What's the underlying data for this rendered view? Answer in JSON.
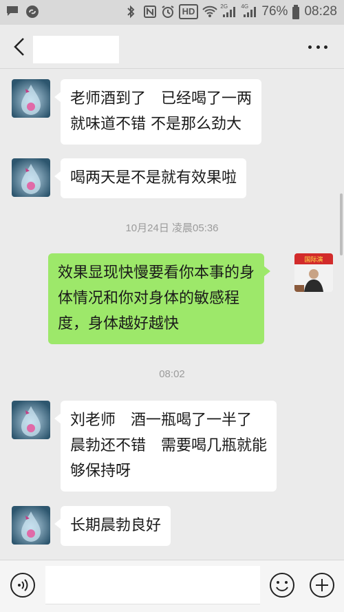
{
  "status_bar": {
    "battery_percent": "76%",
    "time": "08:28",
    "hd_label": "HD",
    "net_2g": "2G",
    "net_4g": "4G"
  },
  "header": {
    "title": ""
  },
  "messages": [
    {
      "direction": "in",
      "lines": [
        "老师酒到了　已经喝了一两",
        "就味道不错  不是那么劲大"
      ]
    },
    {
      "direction": "in",
      "lines": [
        "喝两天是不是就有效果啦"
      ]
    },
    {
      "timestamp": "10月24日 凌晨05:36"
    },
    {
      "direction": "out",
      "lines": [
        "效果显现快慢要看你本事的身",
        "体情况和你对身体的敏感程",
        "度，身体越好越快"
      ]
    },
    {
      "timestamp": "08:02"
    },
    {
      "direction": "in",
      "lines": [
        "刘老师　酒一瓶喝了一半了",
        "晨勃还不错　需要喝几瓶就能",
        "够保持呀"
      ]
    },
    {
      "direction": "in",
      "lines": [
        "长期晨勃良好"
      ]
    }
  ],
  "avatar_banner_text": "国际演",
  "input": {
    "value": "",
    "placeholder": ""
  },
  "colors": {
    "outgoing_bubble": "#9de86a",
    "incoming_bubble": "#ffffff",
    "background": "#ebebeb"
  },
  "icons": {
    "back": "chevron-left-icon",
    "more": "more-dots-icon",
    "voice": "voice-icon",
    "emoji": "emoji-icon",
    "plus": "plus-icon"
  }
}
